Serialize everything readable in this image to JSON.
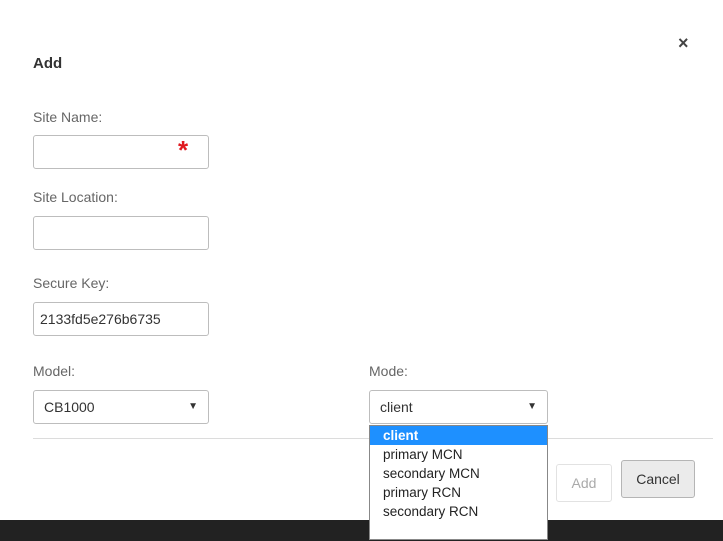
{
  "dialog": {
    "title": "Add",
    "close_glyph": "×"
  },
  "form": {
    "site_name": {
      "label": "Site Name:",
      "value": "",
      "required_marker": "*"
    },
    "site_location": {
      "label": "Site Location:",
      "value": ""
    },
    "secure_key": {
      "label": "Secure Key:",
      "value": "2133fd5e276b6735"
    },
    "model": {
      "label": "Model:",
      "selected": "CB1000",
      "arrow": "▼"
    },
    "mode": {
      "label": "Mode:",
      "selected": "client",
      "arrow": "▼",
      "options": [
        "client",
        "primary MCN",
        "secondary MCN",
        "primary RCN",
        "secondary RCN"
      ]
    }
  },
  "buttons": {
    "add_label": "Add",
    "cancel_label": "Cancel"
  },
  "colors": {
    "required": "#e0191f",
    "selected_option": "#1e90ff",
    "footer": "#222222"
  },
  "icons": {
    "close": "close-icon",
    "required": "required-asterisk",
    "dropdown_arrow": "caret-down-icon"
  }
}
